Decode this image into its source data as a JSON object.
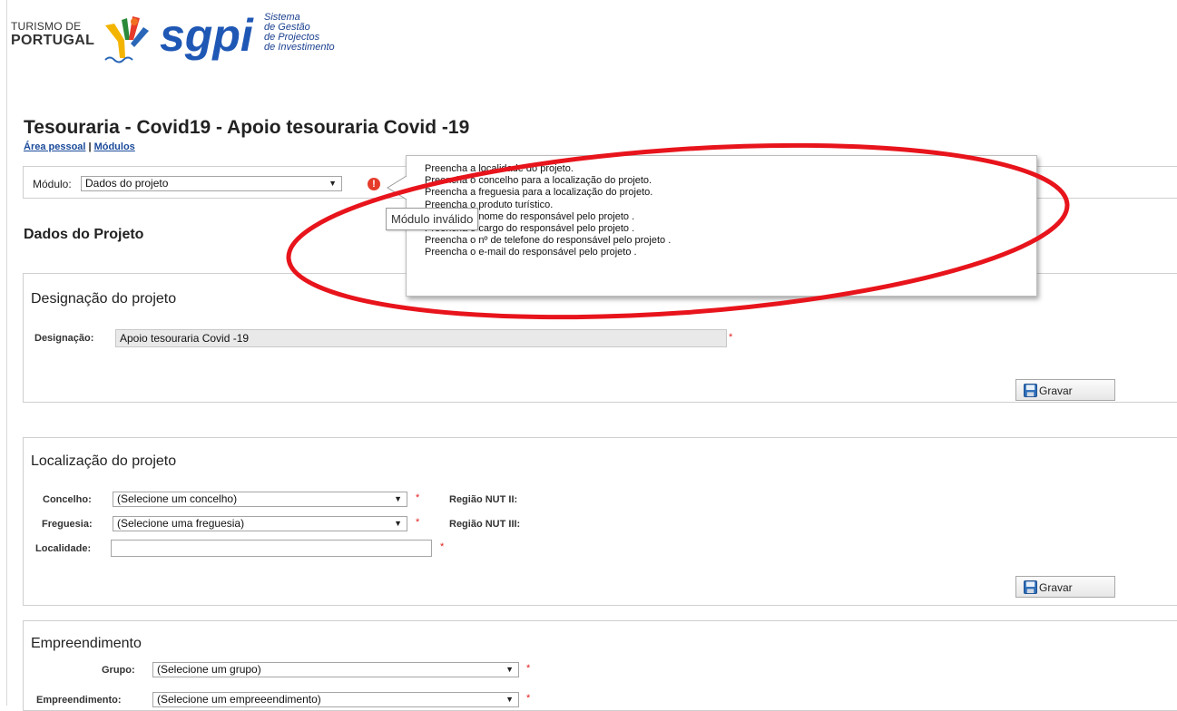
{
  "logo": {
    "turismo_line1": "TURISMO DE",
    "turismo_line2": "PORTUGAL",
    "sgpi": "sgpi",
    "sgpi_sub": [
      "Sistema",
      "de Gestão",
      "de Projectos",
      "de Investimento"
    ]
  },
  "header": {
    "title": "Tesouraria - Covid19 - Apoio tesouraria Covid -19",
    "breadcrumb": {
      "personal_area": "Área pessoal",
      "separator": "|",
      "modules": "Módulos"
    }
  },
  "module_bar": {
    "label": "Módulo:",
    "selected": "Dados do projeto"
  },
  "validation": {
    "tooltip": "Módulo inválido",
    "messages": [
      "Preencha a localidade do projeto.",
      "Preencha o concelho para a localização do projeto.",
      "Preencha a freguesia para a localização do projeto.",
      "Preencha o produto turístico.",
      "Preencha o nome do responsável pelo projeto .",
      "Preencha o cargo do responsável pelo projeto .",
      "Preencha o nº de telefone do responsável pelo projeto .",
      "Preencha o e-mail do responsável pelo projeto ."
    ],
    "highlight_color": "#e8141c",
    "error_color": "#e53c2c"
  },
  "section_title": "Dados do Projeto",
  "designation_panel": {
    "title": "Designação do projeto",
    "label": "Designação:",
    "value": "Apoio tesouraria Covid -19",
    "required": "*",
    "save_label": "Gravar"
  },
  "location_panel": {
    "title": "Localização do projeto",
    "concelho_label": "Concelho:",
    "concelho_value": "(Selecione um concelho)",
    "freguesia_label": "Freguesia:",
    "freguesia_value": "(Selecione uma freguesia)",
    "localidade_label": "Localidade:",
    "localidade_value": "",
    "nut2_label": "Região NUT II:",
    "nut3_label": "Região NUT III:",
    "required": "*",
    "save_label": "Gravar"
  },
  "enterprise_panel": {
    "title": "Empreendimento",
    "grupo_label": "Grupo:",
    "grupo_value": "(Selecione um grupo)",
    "empreendimento_label": "Empreendimento:",
    "empreendimento_value": "(Selecione um empreeendimento)",
    "required": "*"
  }
}
